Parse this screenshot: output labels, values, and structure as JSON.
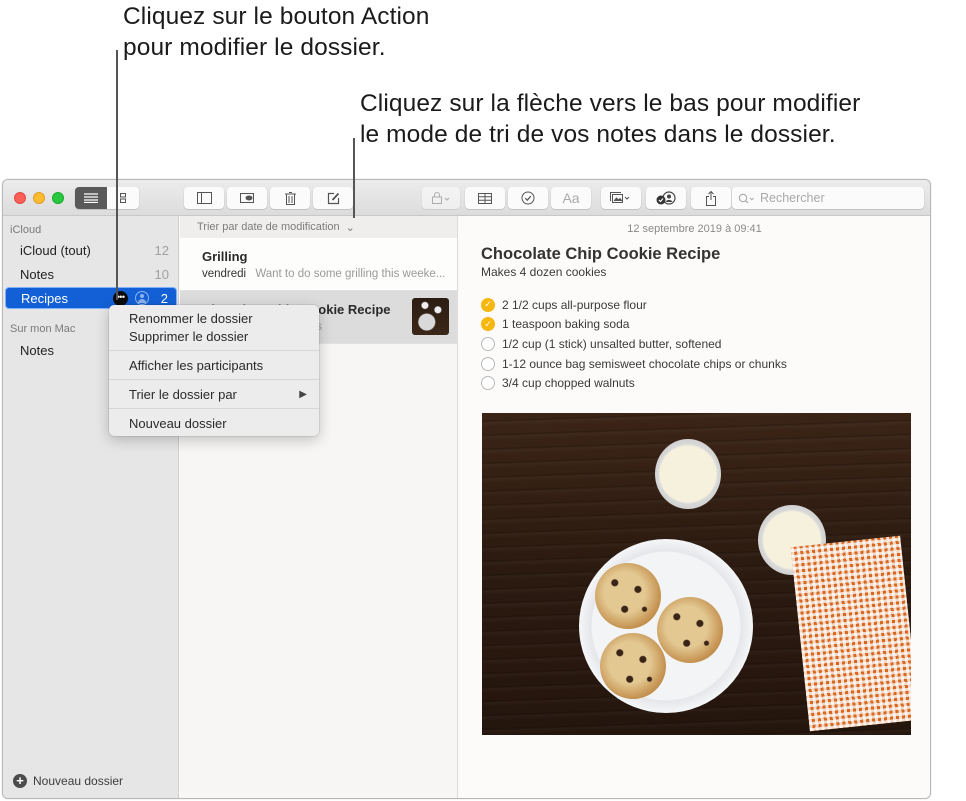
{
  "callouts": {
    "action": {
      "line1": "Cliquez sur le bouton Action",
      "line2": "pour modifier le dossier."
    },
    "sort": {
      "line1": "Cliquez sur la flèche vers le bas pour modifier",
      "line2": "le mode de tri de vos notes dans le dossier."
    }
  },
  "toolbar": {
    "view_list_icon": "list-icon",
    "view_gallery_icon": "gallery-icon",
    "buttons": [
      {
        "name": "toggle-sidebar",
        "icon": "sidebar-icon",
        "glyph": "▯"
      },
      {
        "name": "attachments",
        "icon": "attachments-icon",
        "glyph": "⎘"
      },
      {
        "name": "delete",
        "icon": "trash-icon",
        "glyph": "🗑"
      },
      {
        "name": "new-note",
        "icon": "compose-icon",
        "glyph": "✎"
      },
      {
        "name": "lock",
        "icon": "lock-icon",
        "glyph": "🔒︎ ⌄"
      },
      {
        "name": "table",
        "icon": "table-icon",
        "glyph": "⊞"
      },
      {
        "name": "checklist",
        "icon": "checklist-icon",
        "glyph": "✓"
      },
      {
        "name": "format",
        "icon": "format-icon",
        "glyph": "Aa"
      },
      {
        "name": "media",
        "icon": "media-icon",
        "glyph": "▣⌄"
      },
      {
        "name": "collaborate",
        "icon": "collaborate-icon",
        "glyph": "◉"
      },
      {
        "name": "share",
        "icon": "share-icon",
        "glyph": "⇪"
      }
    ],
    "search_placeholder": "Rechercher"
  },
  "sidebar": {
    "sections": [
      {
        "label": "iCloud",
        "items": [
          {
            "label": "iCloud (tout)",
            "count": "12"
          },
          {
            "label": "Notes",
            "count": "10"
          },
          {
            "label": "Recipes",
            "count": "2",
            "selected": true
          }
        ]
      },
      {
        "label": "Sur mon Mac",
        "items": [
          {
            "label": "Notes",
            "count": ""
          }
        ]
      }
    ],
    "action_button_glyph": "•••",
    "new_folder_label": "Nouveau dossier"
  },
  "context_menu": {
    "items": [
      {
        "label": "Renommer le dossier"
      },
      {
        "label": "Supprimer le dossier"
      },
      {
        "label": "Afficher les participants"
      },
      {
        "label": "Trier le dossier par",
        "submenu": true
      },
      {
        "label": "Nouveau dossier"
      }
    ],
    "submenu_arrow": "▶"
  },
  "note_list": {
    "sort_label": "Trier par date de modification",
    "sort_arrow": "⌄",
    "notes": [
      {
        "title": "Grilling",
        "date": "vendredi",
        "preview": "Want to do some grilling this weeke..."
      },
      {
        "title": "Chocolate Chip Cookie Recipe",
        "date": "",
        "preview": "Makes 4 dozen cookies",
        "selected": true,
        "has_thumbnail": true
      }
    ]
  },
  "editor": {
    "date": "12 septembre 2019 à 09:41",
    "title": "Chocolate Chip Cookie Recipe",
    "subtitle": "Makes 4 dozen cookies",
    "checklist": [
      {
        "text": "2 1/2 cups all-purpose flour",
        "checked": true
      },
      {
        "text": "1 teaspoon baking soda",
        "checked": true
      },
      {
        "text": "1/2 cup (1 stick) unsalted butter, softened",
        "checked": false
      },
      {
        "text": "1-12 ounce bag semisweet chocolate chips or chunks",
        "checked": false
      },
      {
        "text": "3/4 cup chopped walnuts",
        "checked": false
      }
    ],
    "image_description": "Photo of chocolate chip cookies on a white plate with two glasses of milk and an orange gingham napkin on a dark wood table"
  },
  "colors": {
    "selection_blue": "#1360d6",
    "checkbox_yellow": "#f6b70f"
  }
}
